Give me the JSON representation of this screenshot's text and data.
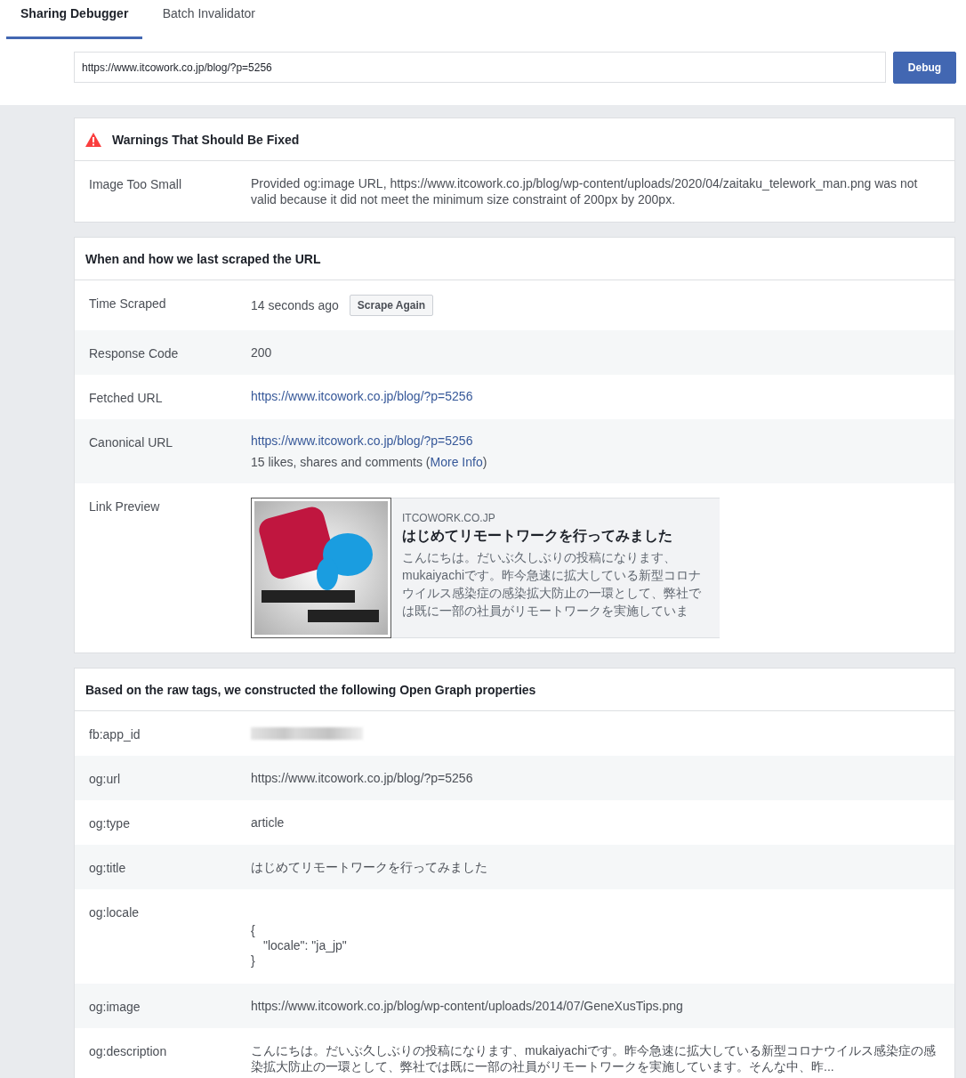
{
  "tabs": [
    {
      "label": "Sharing Debugger",
      "selected": true
    },
    {
      "label": "Batch Invalidator",
      "selected": false
    }
  ],
  "url_field": {
    "value": "https://www.itcowork.co.jp/blog/?p=5256"
  },
  "debug_button": "Debug",
  "warnings": {
    "title": "Warnings That Should Be Fixed",
    "rows": [
      {
        "label": "Image Too Small",
        "text": "Provided og:image URL, https://www.itcowork.co.jp/blog/wp-content/uploads/2020/04/zaitaku_telework_man.png was not valid because it did not meet the minimum size constraint of 200px by 200px."
      }
    ]
  },
  "scrape": {
    "title": "When and how we last scraped the URL",
    "rows": [
      {
        "kind": "text_button",
        "label": "Time Scraped",
        "value": "14 seconds ago",
        "button": "Scrape Again"
      },
      {
        "kind": "text",
        "label": "Response Code",
        "value": "200"
      },
      {
        "kind": "link",
        "label": "Fetched URL",
        "value": "https://www.itcowork.co.jp/blog/?p=5256"
      },
      {
        "kind": "link_note",
        "label": "Canonical URL",
        "value": "https://www.itcowork.co.jp/blog/?p=5256",
        "note_prefix": "15 likes, shares and comments (",
        "note_link": "More Info",
        "note_suffix": ")"
      },
      {
        "kind": "preview",
        "label": "Link Preview",
        "preview": {
          "domain": "ITCOWORK.CO.JP",
          "title": "はじめてリモートワークを行ってみました",
          "description": "こんにちは。だいぶ久しぶりの投稿になります、mukaiyachiです。昨今急速に拡大している新型コロナウイルス感染症の感染拡大防止の一環として、弊社では既に一部の社員がリモートワークを実施していま"
        }
      }
    ]
  },
  "og": {
    "title": "Based on the raw tags, we constructed the following Open Graph properties",
    "rows": [
      {
        "kind": "blurred",
        "label": "fb:app_id"
      },
      {
        "kind": "text",
        "label": "og:url",
        "value": "https://www.itcowork.co.jp/blog/?p=5256"
      },
      {
        "kind": "text",
        "label": "og:type",
        "value": "article"
      },
      {
        "kind": "text",
        "label": "og:title",
        "value": "はじめてリモートワークを行ってみました"
      },
      {
        "kind": "code",
        "label": "og:locale",
        "lines": [
          {
            "text": "{",
            "indented": false
          },
          {
            "text": "\"locale\": \"ja_jp\"",
            "indented": true
          },
          {
            "text": "}",
            "indented": false
          }
        ]
      },
      {
        "kind": "text",
        "label": "og:image",
        "value": "https://www.itcowork.co.jp/blog/wp-content/uploads/2014/07/GeneXusTips.png"
      },
      {
        "kind": "text",
        "label": "og:description",
        "value": "こんにちは。だいぶ久しぶりの投稿になります、mukaiyachiです。昨今急速に拡大している新型コロナウイルス感染症の感染拡大防止の一環として、弊社では既に一部の社員がリモートワークを実施しています。そんな中、昨..."
      }
    ]
  }
}
